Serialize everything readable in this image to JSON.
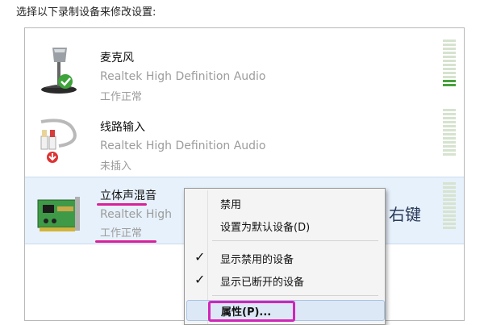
{
  "instruction": "选择以下录制设备来修改设置:",
  "devices": [
    {
      "name": "麦克风",
      "description": "Realtek High Definition Audio",
      "status": "工作正常",
      "icon": "microphone-icon",
      "status_badge": "green-check-icon"
    },
    {
      "name": "线路输入",
      "description": "Realtek High Definition Audio",
      "status": "未插入",
      "icon": "line-in-cable-icon",
      "status_badge": "red-down-arrow-icon"
    },
    {
      "name": "立体声混音",
      "description": "Realtek High",
      "status": "工作正常",
      "icon": "sound-card-icon"
    }
  ],
  "annotation": "右键",
  "context_menu": {
    "items": [
      {
        "label": "禁用",
        "checked": false
      },
      {
        "label": "设置为默认设备(D)",
        "checked": false
      },
      {
        "label": "显示禁用的设备",
        "checked": true
      },
      {
        "label": "显示已断开的设备",
        "checked": true
      },
      {
        "label": "属性(P)...",
        "checked": false,
        "highlighted": true
      }
    ],
    "check_glyph": "✓"
  },
  "colors": {
    "selection_bg": "#e7f1fb",
    "level_on": "#47a23a",
    "highlight_marker": "#d9209a",
    "menu_highlight_bg": "#dce8f6"
  }
}
